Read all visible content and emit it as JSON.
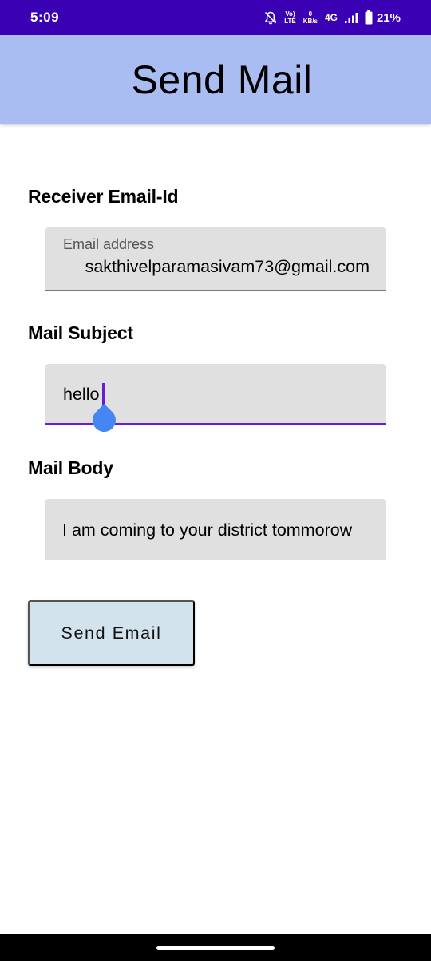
{
  "status_bar": {
    "time": "5:09",
    "volte_top": "Vo)",
    "volte_bottom": "LTE",
    "speed_value": "0",
    "speed_unit": "KB/s",
    "network": "4G",
    "battery": "21%",
    "icons": [
      "bell-off-icon",
      "volte-icon",
      "data-speed",
      "signal-icon",
      "battery-icon"
    ],
    "color": "#3A00B4"
  },
  "app_bar": {
    "title": "Send Mail",
    "color": "#AABDF2"
  },
  "form": {
    "receiver_label": "Receiver Email-Id",
    "email_field": {
      "floating_label": "Email address",
      "value": "sakthivelparamasivam73@gmail.com"
    },
    "subject_label": "Mail Subject",
    "subject_field": {
      "value": "hello"
    },
    "body_label": "Mail Body",
    "body_field": {
      "value": "I am coming to your district tommorow"
    },
    "send_button": "Send Email"
  },
  "colors": {
    "focus": "#6A1BD8",
    "cursor_handle": "#4386F4",
    "button": "#D3E3EE",
    "field_bg": "#E0E0E0"
  }
}
